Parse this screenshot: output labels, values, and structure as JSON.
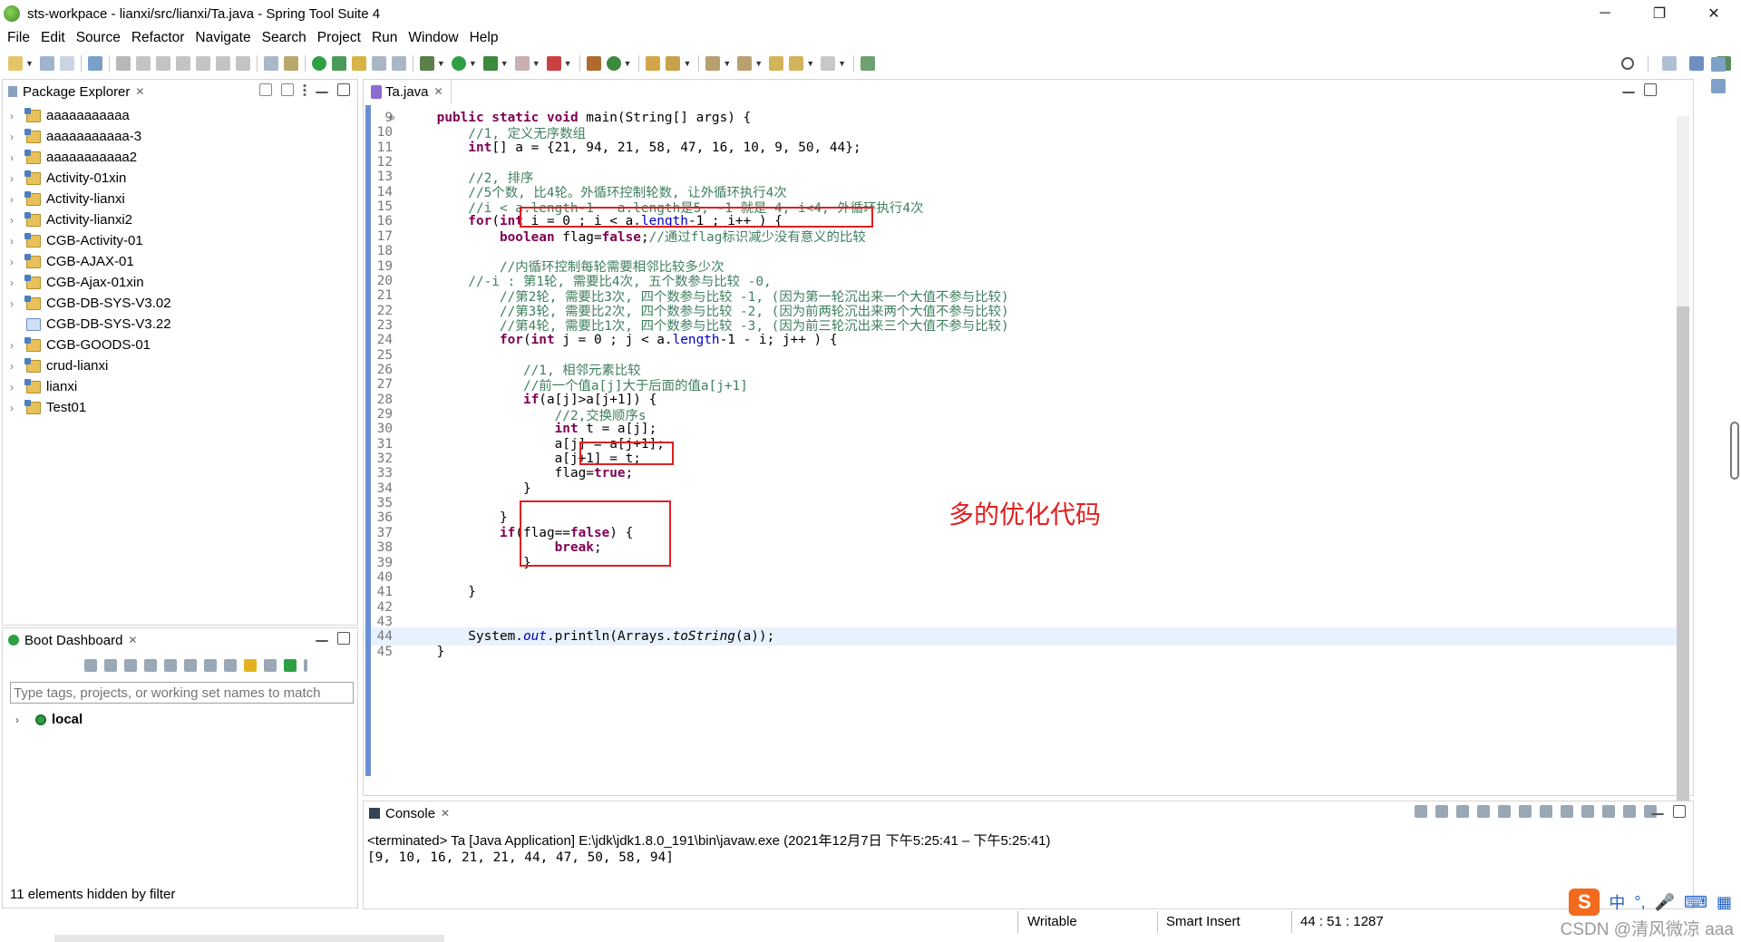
{
  "window": {
    "title": "sts-workpace - lianxi/src/lianxi/Ta.java - Spring Tool Suite 4",
    "minimize": "─",
    "restore": "❐",
    "close": "✕"
  },
  "menu": [
    "File",
    "Edit",
    "Source",
    "Refactor",
    "Navigate",
    "Search",
    "Project",
    "Run",
    "Window",
    "Help"
  ],
  "package_explorer": {
    "title": "Package Explorer",
    "projects": [
      "aaaaaaaaaaa",
      "aaaaaaaaaaa-3",
      "aaaaaaaaaaa2",
      "Activity-01xin",
      "Activity-lianxi",
      "Activity-lianxi2",
      "CGB-Activity-01",
      "CGB-AJAX-01",
      "CGB-Ajax-01xin",
      "CGB-DB-SYS-V3.02",
      "CGB-DB-SYS-V3.22",
      "CGB-GOODS-01",
      "crud-lianxi",
      "lianxi",
      "Test01"
    ]
  },
  "boot_dashboard": {
    "title": "Boot Dashboard",
    "filter_placeholder": "Type tags, projects, or working set names to match",
    "local_label": "local",
    "hidden_note": "11 elements hidden by filter"
  },
  "editor": {
    "tab_label": "Ta.java",
    "fold_marker": "⊖",
    "annotation": "多的优化代码",
    "lines": [
      {
        "n": "9",
        "segs": [
          [
            "kw",
            "    public static void "
          ],
          [
            "plain",
            "main(String[] args) {"
          ]
        ]
      },
      {
        "n": "10",
        "segs": [
          [
            "cm",
            "        //1, 定义无序数组"
          ]
        ]
      },
      {
        "n": "11",
        "segs": [
          [
            "kw",
            "        int"
          ],
          [
            "plain",
            "[] a = {21, 94, 21, 58, 47, 16, 10, 9, 50, 44};"
          ]
        ]
      },
      {
        "n": "12",
        "segs": []
      },
      {
        "n": "13",
        "segs": [
          [
            "cm",
            "        //2, 排序"
          ]
        ]
      },
      {
        "n": "14",
        "segs": [
          [
            "cm",
            "        //5个数, 比4轮。外循环控制轮数, 让外循环执行4次"
          ]
        ]
      },
      {
        "n": "15",
        "segs": [
          [
            "cm",
            "        //i < a.length-1   a.length是5, -1 就是 4, i<4, 外循环执行4次"
          ]
        ]
      },
      {
        "n": "16",
        "segs": [
          [
            "kw",
            "        for"
          ],
          [
            "plain",
            "("
          ],
          [
            "kw",
            "int"
          ],
          [
            "plain",
            " i = 0 ; i < a."
          ],
          [
            "fld",
            "length"
          ],
          [
            "plain",
            "-1 ; i++ ) {"
          ]
        ]
      },
      {
        "n": "17",
        "segs": [
          [
            "kw",
            "            boolean"
          ],
          [
            "plain",
            " flag="
          ],
          [
            "kw",
            "false"
          ],
          [
            "plain",
            ";"
          ],
          [
            "cm",
            "//通过flag标识减少没有意义的比较"
          ]
        ]
      },
      {
        "n": "18",
        "segs": []
      },
      {
        "n": "19",
        "segs": [
          [
            "cm",
            "            //内循环控制每轮需要相邻比较多少次"
          ]
        ]
      },
      {
        "n": "20",
        "segs": [
          [
            "cm",
            "        //-i : 第1轮, 需要比4次, 五个数参与比较 -0,"
          ]
        ]
      },
      {
        "n": "21",
        "segs": [
          [
            "cm",
            "            //第2轮, 需要比3次, 四个数参与比较 -1, (因为第一轮沉出来一个大值不参与比较)"
          ]
        ]
      },
      {
        "n": "22",
        "segs": [
          [
            "cm",
            "            //第3轮, 需要比2次, 四个数参与比较 -2, (因为前两轮沉出来两个大值不参与比较)"
          ]
        ]
      },
      {
        "n": "23",
        "segs": [
          [
            "cm",
            "            //第4轮, 需要比1次, 四个数参与比较 -3, (因为前三轮沉出来三个大值不参与比较)"
          ]
        ]
      },
      {
        "n": "24",
        "segs": [
          [
            "kw",
            "            for"
          ],
          [
            "plain",
            "("
          ],
          [
            "kw",
            "int"
          ],
          [
            "plain",
            " j = 0 ; j < a."
          ],
          [
            "fld",
            "length"
          ],
          [
            "plain",
            "-1 - i; j++ ) {"
          ]
        ]
      },
      {
        "n": "25",
        "segs": []
      },
      {
        "n": "26",
        "segs": [
          [
            "cm",
            "               //1, 相邻元素比较"
          ]
        ]
      },
      {
        "n": "27",
        "segs": [
          [
            "cm",
            "               //前一个值a[j]大于后面的值a[j+1]"
          ]
        ]
      },
      {
        "n": "28",
        "segs": [
          [
            "kw",
            "               if"
          ],
          [
            "plain",
            "(a[j]>a[j+1]) {"
          ]
        ]
      },
      {
        "n": "29",
        "segs": [
          [
            "cm",
            "                   //2,交换顺序s"
          ]
        ]
      },
      {
        "n": "30",
        "segs": [
          [
            "kw",
            "                   int"
          ],
          [
            "plain",
            " t = a[j];"
          ]
        ]
      },
      {
        "n": "31",
        "segs": [
          [
            "plain",
            "                   a[j] = a[j+1];"
          ]
        ]
      },
      {
        "n": "32",
        "segs": [
          [
            "plain",
            "                   a[j+1] = t;"
          ]
        ]
      },
      {
        "n": "33",
        "segs": [
          [
            "plain",
            "                   flag="
          ],
          [
            "kw",
            "true"
          ],
          [
            "plain",
            ";"
          ]
        ]
      },
      {
        "n": "34",
        "segs": [
          [
            "plain",
            "               }"
          ]
        ]
      },
      {
        "n": "35",
        "segs": []
      },
      {
        "n": "36",
        "segs": [
          [
            "plain",
            "            }"
          ]
        ]
      },
      {
        "n": "37",
        "segs": [
          [
            "kw",
            "            if"
          ],
          [
            "plain",
            "(flag=="
          ],
          [
            "kw",
            "false"
          ],
          [
            "plain",
            ") {"
          ]
        ]
      },
      {
        "n": "38",
        "segs": [
          [
            "kw",
            "                   break"
          ],
          [
            "plain",
            ";"
          ]
        ]
      },
      {
        "n": "39",
        "segs": [
          [
            "plain",
            "               }"
          ]
        ]
      },
      {
        "n": "40",
        "segs": []
      },
      {
        "n": "41",
        "segs": [
          [
            "plain",
            "        }"
          ]
        ]
      },
      {
        "n": "42",
        "segs": []
      },
      {
        "n": "43",
        "segs": []
      },
      {
        "n": "44",
        "segs": [
          [
            "plain",
            "        System."
          ],
          [
            "st",
            "out"
          ],
          [
            "plain",
            "."
          ],
          [
            "plain",
            "println(Arrays."
          ],
          [
            "mth",
            "toString"
          ],
          [
            "plain",
            "(a));"
          ]
        ]
      },
      {
        "n": "45",
        "segs": [
          [
            "plain",
            "    }"
          ]
        ]
      }
    ]
  },
  "console": {
    "title": "Console",
    "terminated": "<terminated> Ta [Java Application] E:\\jdk\\jdk1.8.0_191\\bin\\javaw.exe  (2021年12月7日 下午5:25:41 – 下午5:25:41)",
    "output": "[9, 10, 16, 21, 21, 44, 47, 50, 58, 94]"
  },
  "status": {
    "writable": "Writable",
    "insert_mode": "Smart Insert",
    "position": "44 : 51 : 1287"
  },
  "ime": {
    "logo": "S",
    "lang": "中",
    "punct": "°,",
    "mic": "🎤",
    "keyboard": "⌨",
    "grid": "▦"
  },
  "watermark": "CSDN @清风微凉 aaa"
}
